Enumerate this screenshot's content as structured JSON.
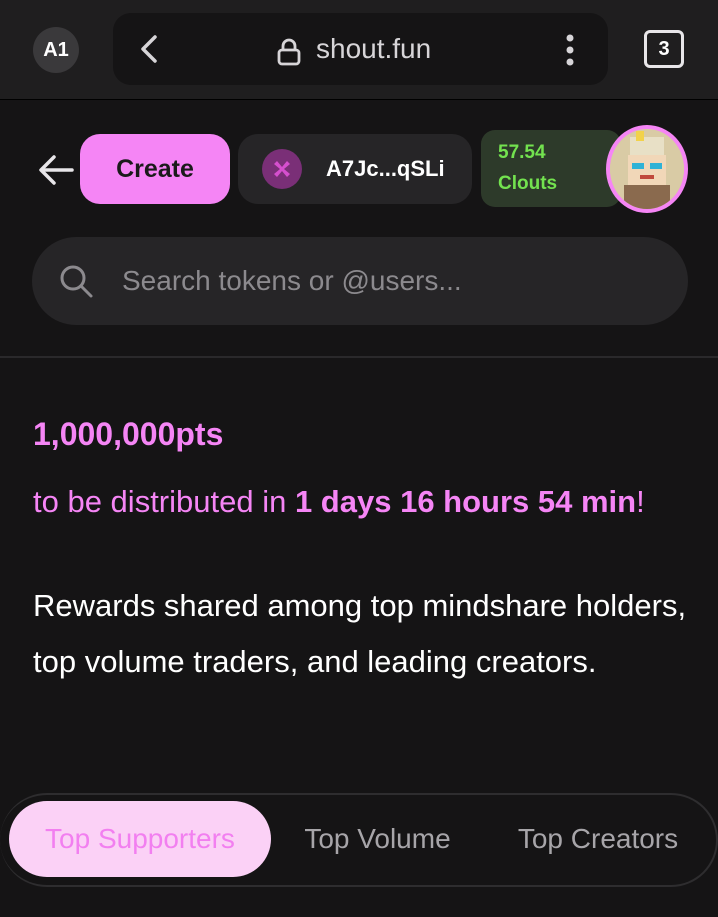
{
  "browser": {
    "profile_badge": "A1",
    "url": "shout.fun",
    "tab_count": "3"
  },
  "header": {
    "create_label": "Create",
    "wallet_address": "A7Jc...qSLi",
    "clouts_value": "57.54",
    "clouts_label": "Clouts"
  },
  "search": {
    "placeholder": "Search tokens or @users..."
  },
  "rewards": {
    "points": "1,000,000pts",
    "distribute_prefix": "to be distributed in ",
    "countdown": "1 days 16 hours 54 min",
    "distribute_suffix": "!",
    "description": "Rewards shared among top mindshare holders, top volume traders, and leading creators."
  },
  "tabs": [
    {
      "label": "Top Supporters",
      "active": true
    },
    {
      "label": "Top Volume",
      "active": false
    },
    {
      "label": "Top Creators",
      "active": false
    }
  ],
  "colors": {
    "accent": "#f585f5",
    "clouts": "#73e24f",
    "background": "#151415"
  }
}
